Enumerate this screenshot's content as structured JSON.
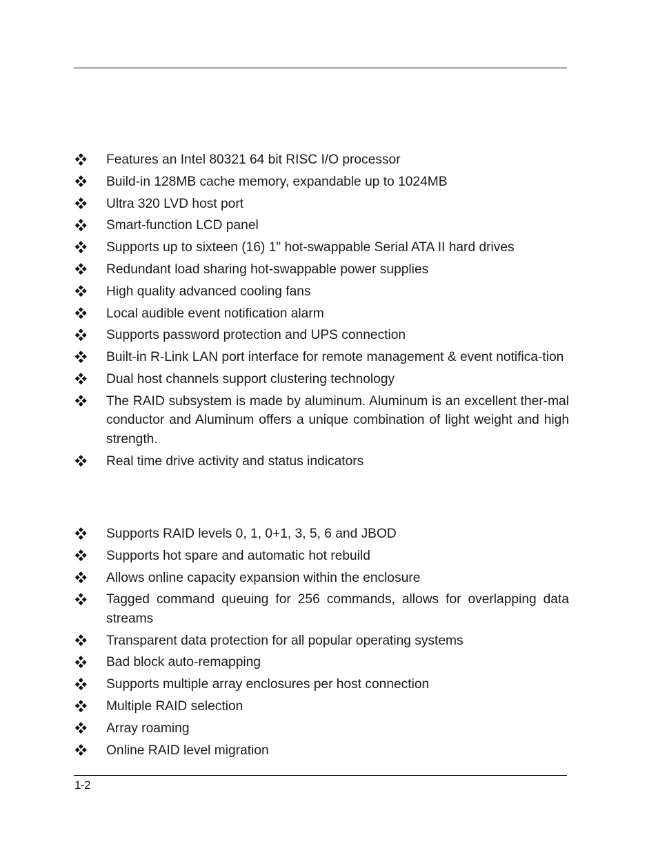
{
  "page": {
    "page_number": "1-2"
  },
  "hardware_features": [
    {
      "bullet_icon": "diamond-bullet-icon",
      "text": "Features an Intel 80321 64 bit RISC I/O processor"
    },
    {
      "bullet_icon": "diamond-bullet-icon",
      "text": "Build-in 128MB cache memory, expandable up to 1024MB"
    },
    {
      "bullet_icon": "diamond-bullet-icon",
      "text": "Ultra 320 LVD host port"
    },
    {
      "bullet_icon": "diamond-bullet-icon",
      "text": "Smart-function LCD panel"
    },
    {
      "bullet_icon": "diamond-bullet-icon",
      "text": "Supports up to sixteen (16) 1\" hot-swappable Serial ATA II hard drives"
    },
    {
      "bullet_icon": "diamond-bullet-icon",
      "text": "Redundant load sharing hot-swappable power supplies"
    },
    {
      "bullet_icon": "diamond-bullet-icon",
      "text": "High quality advanced cooling fans"
    },
    {
      "bullet_icon": "diamond-bullet-icon",
      "text": "Local audible event notification alarm"
    },
    {
      "bullet_icon": "diamond-bullet-icon",
      "text": "Supports password protection and UPS connection"
    },
    {
      "bullet_icon": "diamond-bullet-icon",
      "text": "Built-in R-Link LAN port interface for remote management & event notifica-tion"
    },
    {
      "bullet_icon": "diamond-bullet-icon",
      "text": "Dual host channels support clustering technology"
    },
    {
      "bullet_icon": "diamond-bullet-icon",
      "text": "The RAID subsystem is made by aluminum. Aluminum is an excellent ther-mal conductor and Aluminum offers a unique combination of light weight and high strength."
    },
    {
      "bullet_icon": "diamond-bullet-icon",
      "text": "Real time drive activity and status indicators"
    }
  ],
  "raid_features": [
    {
      "bullet_icon": "diamond-bullet-icon",
      "text": "Supports RAID levels 0, 1, 0+1, 3, 5, 6 and JBOD"
    },
    {
      "bullet_icon": "diamond-bullet-icon",
      "text": "Supports hot spare and automatic hot rebuild"
    },
    {
      "bullet_icon": "diamond-bullet-icon",
      "text": "Allows online capacity expansion within the enclosure"
    },
    {
      "bullet_icon": "diamond-bullet-icon",
      "text": "Tagged command queuing for 256 commands, allows for overlapping data streams"
    },
    {
      "bullet_icon": "diamond-bullet-icon",
      "text": "Transparent data protection for all popular operating systems"
    },
    {
      "bullet_icon": "diamond-bullet-icon",
      "text": "Bad block auto-remapping"
    },
    {
      "bullet_icon": "diamond-bullet-icon",
      "text": "Supports multiple array enclosures per host connection"
    },
    {
      "bullet_icon": "diamond-bullet-icon",
      "text": "Multiple RAID selection"
    },
    {
      "bullet_icon": "diamond-bullet-icon",
      "text": "Array roaming"
    },
    {
      "bullet_icon": "diamond-bullet-icon",
      "text": "Online RAID level migration"
    }
  ]
}
